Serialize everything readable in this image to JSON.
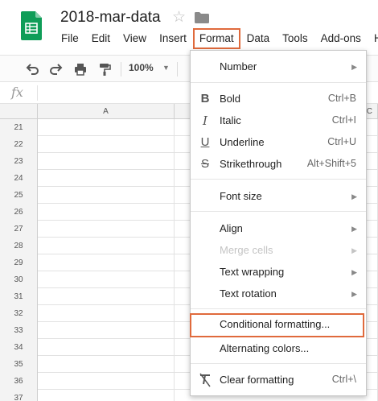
{
  "doc": {
    "title": "2018-mar-data"
  },
  "menubar": {
    "file": "File",
    "edit": "Edit",
    "view": "View",
    "insert": "Insert",
    "format": "Format",
    "data": "Data",
    "tools": "Tools",
    "addons": "Add-ons",
    "help": "He"
  },
  "toolbar": {
    "zoom": "100%"
  },
  "formula": {
    "fx": "fx"
  },
  "grid": {
    "columns": [
      "A",
      "C"
    ],
    "rows": [
      "21",
      "22",
      "23",
      "24",
      "25",
      "26",
      "27",
      "28",
      "29",
      "30",
      "31",
      "32",
      "33",
      "34",
      "35",
      "36",
      "37"
    ]
  },
  "format_menu": {
    "number": "Number",
    "bold": {
      "label": "Bold",
      "shortcut": "Ctrl+B"
    },
    "italic": {
      "label": "Italic",
      "shortcut": "Ctrl+I"
    },
    "underline": {
      "label": "Underline",
      "shortcut": "Ctrl+U"
    },
    "strikethrough": {
      "label": "Strikethrough",
      "shortcut": "Alt+Shift+5"
    },
    "font_size": "Font size",
    "align": "Align",
    "merge_cells": "Merge cells",
    "text_wrapping": "Text wrapping",
    "text_rotation": "Text rotation",
    "conditional_formatting": "Conditional formatting...",
    "alternating_colors": "Alternating colors...",
    "clear_formatting": {
      "label": "Clear formatting",
      "shortcut": "Ctrl+\\"
    }
  },
  "icons": {
    "bold": "B",
    "italic": "I",
    "underline": "U",
    "strikethrough": "S",
    "star": "☆",
    "submenu_arrow": "▶"
  },
  "colors": {
    "sheets_green": "#0f9d58",
    "highlight_border": "#e06a3c"
  }
}
